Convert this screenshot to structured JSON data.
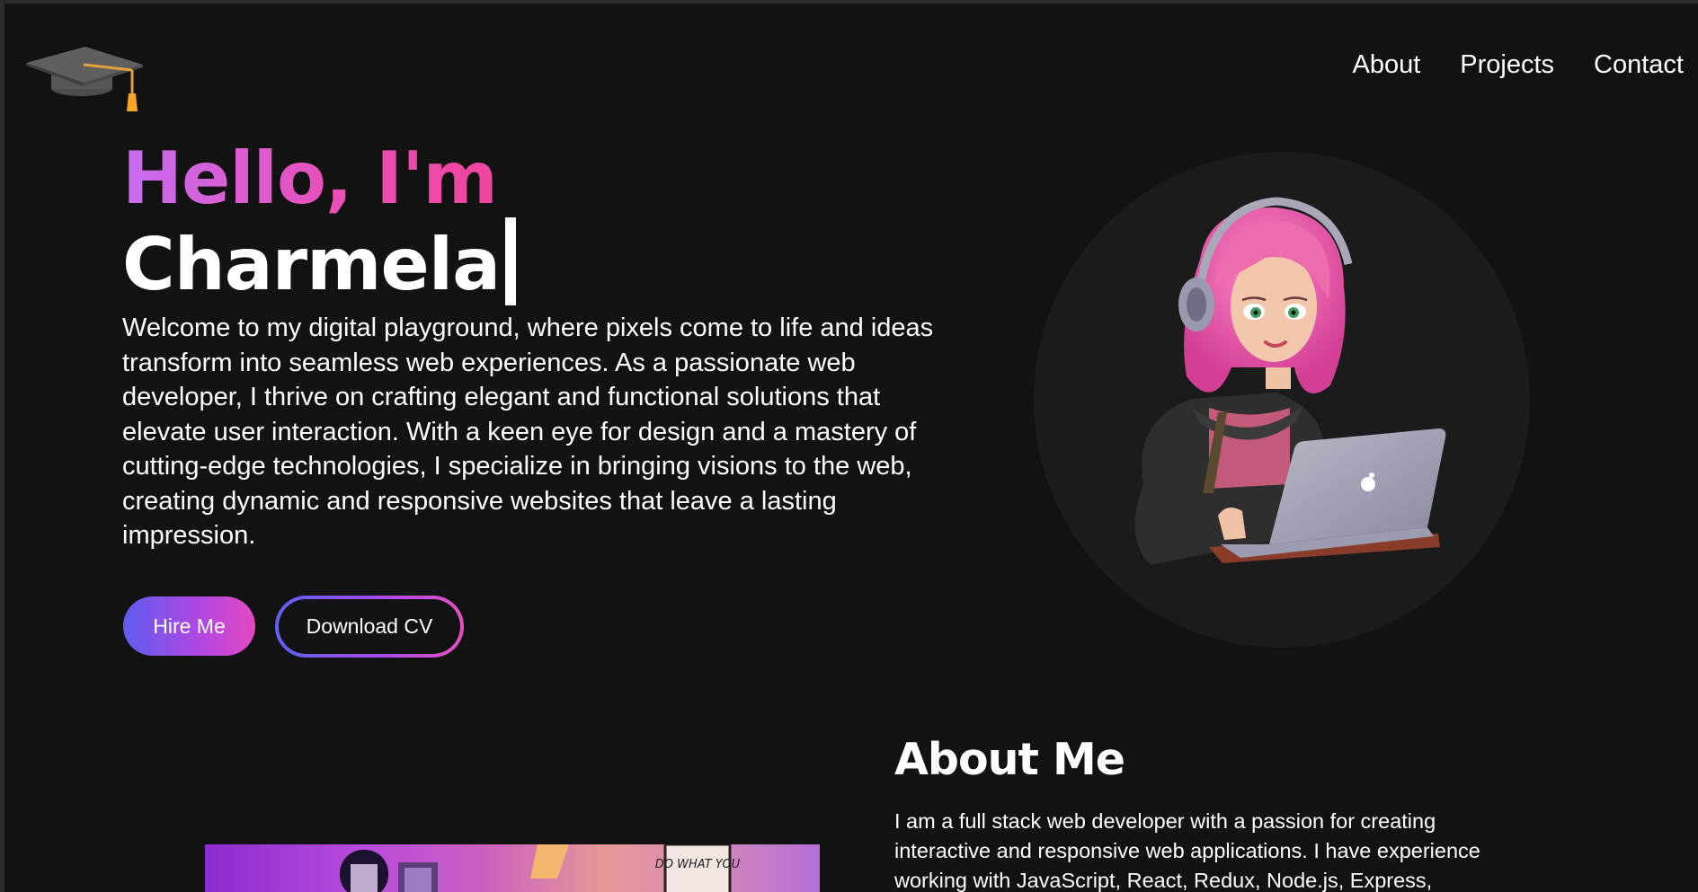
{
  "nav": {
    "logo_icon": "graduation-cap-icon",
    "links": [
      "About",
      "Projects",
      "Contact"
    ]
  },
  "hero": {
    "greeting": "Hello, I'm",
    "name": "Charmela",
    "intro": "Welcome to my digital playground, where pixels come to life and ideas transform into seamless web experiences. As a passionate web developer, I thrive on crafting elegant and functional solutions that elevate user interaction. With a keen eye for design and a mastery of cutting-edge technologies, I specialize in bringing visions to the web, creating dynamic and responsive websites that leave a lasting impression.",
    "hire_label": "Hire Me",
    "cv_label": "Download CV",
    "avatar_image": "avatar-girl-with-headphones-and-laptop"
  },
  "about": {
    "title": "About Me",
    "text": "I am a full stack web developer with a passion for creating interactive and responsive web applications. I have experience working with JavaScript, React, Redux, Node.js, Express,",
    "photo_sign_text": "DO WHAT YOU"
  },
  "colors": {
    "background": "#121212",
    "accent_purple": "#c86df2",
    "accent_pink": "#f0449a",
    "accent_blue": "#5f5cf0",
    "text": "#ffffff"
  }
}
